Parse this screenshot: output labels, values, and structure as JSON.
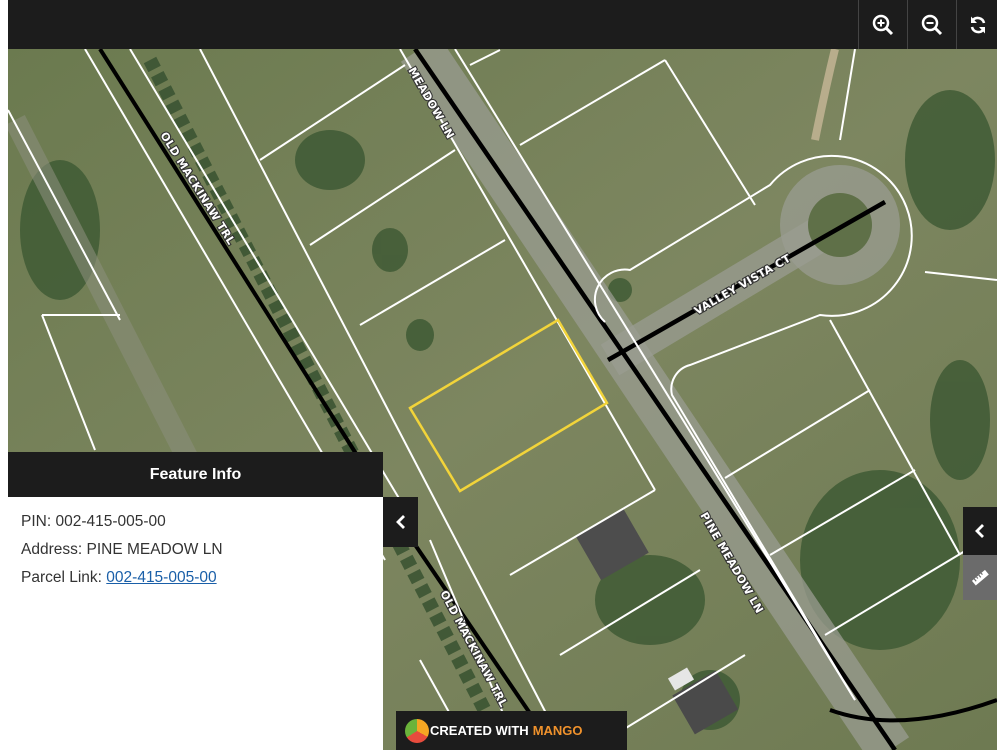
{
  "toolbar": {
    "zoom_in_icon": "zoom-in-icon",
    "zoom_out_icon": "zoom-out-icon",
    "refresh_icon": "refresh-icon"
  },
  "map": {
    "road_labels": {
      "meadow_top": "MEADOW LN",
      "old_mackinaw_1": "OLD MACKINAW TRL",
      "valley_vista": "VALLEY VISTA CT",
      "pine_meadow": "PINE MEADOW LN",
      "old_mackinaw_2": "OLD MACKINAW TRL"
    },
    "colors": {
      "selected_parcel": "#f2d43a",
      "parcel_lines": "#ffffff",
      "road_center": "#000000"
    }
  },
  "feature_info": {
    "title": "Feature Info",
    "pin_label": "PIN:",
    "pin_value": "002-415-005-00",
    "address_label": "Address:",
    "address_value": "PINE MEADOW LN",
    "parcel_link_label": "Parcel Link:",
    "parcel_link_value": "002-415-005-00"
  },
  "credit": {
    "prefix": "CREATED WITH",
    "brand": "MANGO"
  }
}
